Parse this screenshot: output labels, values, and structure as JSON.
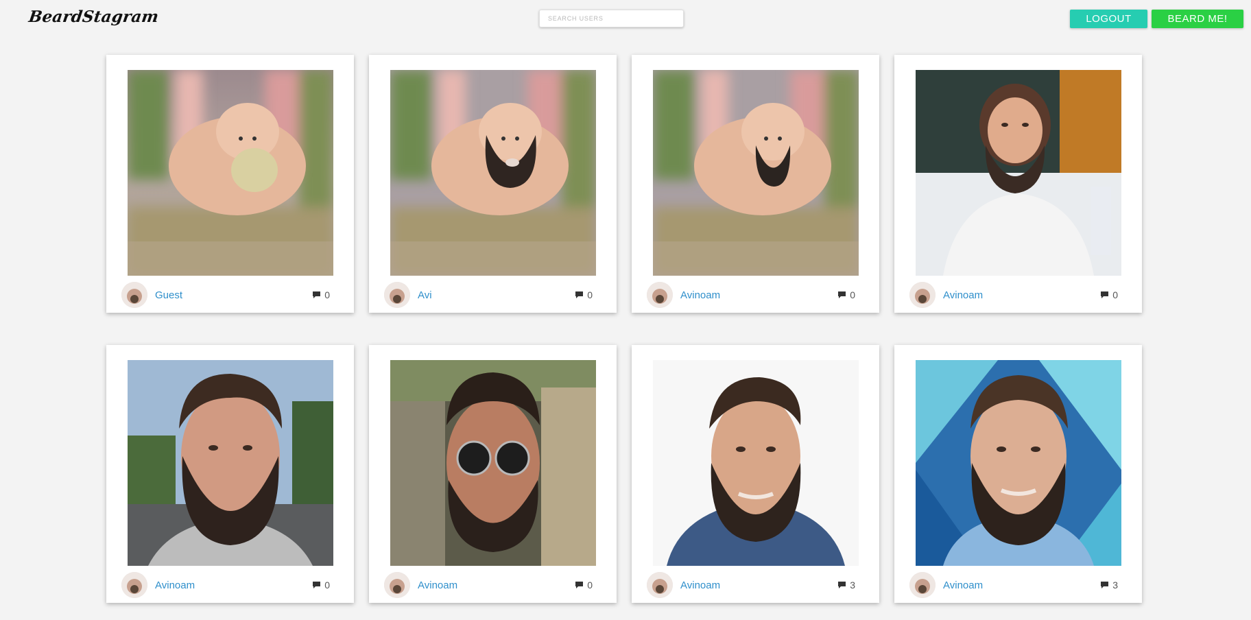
{
  "header": {
    "logo": "BeardStagram",
    "search_placeholder": "SEARCH USERS",
    "logout_label": "LOGOUT",
    "beard_me_label": "BEARD ME!",
    "colors": {
      "logout": "#26cdb1",
      "beard_me": "#2ad044",
      "username_link": "#2f8fcb"
    }
  },
  "posts": [
    {
      "username": "Guest",
      "comment_count": "0",
      "photo": "cat-with-blonde-beard",
      "comment_icon": "speech-bubble-icon"
    },
    {
      "username": "Avi",
      "comment_count": "0",
      "photo": "cat-with-dark-beard",
      "comment_icon": "speech-bubble-icon"
    },
    {
      "username": "Avinoam",
      "comment_count": "0",
      "photo": "cat-with-small-beard",
      "comment_icon": "speech-bubble-icon"
    },
    {
      "username": "Avinoam",
      "comment_count": "0",
      "photo": "woman-lab-coat-beard",
      "comment_icon": "speech-bubble-icon"
    },
    {
      "username": "Avinoam",
      "comment_count": "0",
      "photo": "man-outdoors-beard",
      "comment_icon": "speech-bubble-icon"
    },
    {
      "username": "Avinoam",
      "comment_count": "0",
      "photo": "man-sunglasses-beard",
      "comment_icon": "speech-bubble-icon"
    },
    {
      "username": "Avinoam",
      "comment_count": "3",
      "photo": "man-denim-shirt-beard",
      "comment_icon": "speech-bubble-icon"
    },
    {
      "username": "Avinoam",
      "comment_count": "3",
      "photo": "man-blue-background-beard",
      "comment_icon": "speech-bubble-icon"
    }
  ]
}
